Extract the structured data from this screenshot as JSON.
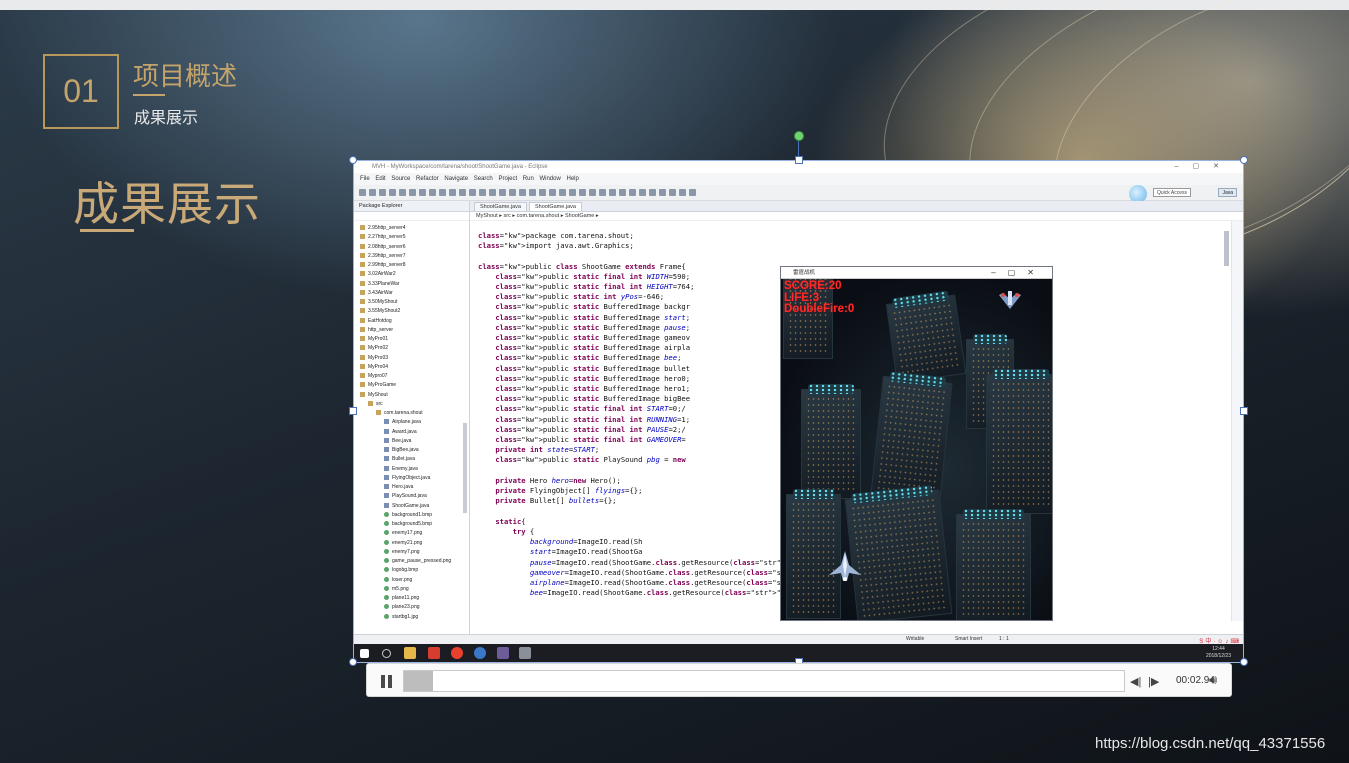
{
  "slide": {
    "section_number": "01",
    "section_title": "项目概述",
    "section_subtitle": "成果展示",
    "main_title": "成果展示",
    "watermark": "https://blog.csdn.net/qq_43371556"
  },
  "eclipse": {
    "window_title": "MVH - MyWorkspace/com/tarena/shoot/ShootGame.java - Eclipse",
    "menu": [
      "File",
      "Edit",
      "Source",
      "Refactor",
      "Navigate",
      "Search",
      "Project",
      "Run",
      "Window",
      "Help"
    ],
    "quick_access": "Quick Access",
    "perspective": "Java",
    "package_explorer_title": "Package Explorer",
    "tree_items": [
      "2.95http_server4",
      "2.27http_server5",
      "2.08http_server6",
      "2.39http_server7",
      "2.99http_server8",
      "3.02AirWar2",
      "3.33PlaneWar",
      "3.43AirWar",
      "3.50MyShout",
      "3.55MyShout2",
      "EatHotdog",
      "http_server",
      "MyPro01",
      "MyPro02",
      "MyPro03",
      "MyPro04",
      "Mypro07",
      "MyProGame",
      "MyShout",
      "src",
      "com.tarena.shout",
      "Airplane.java",
      "Award.java",
      "Bee.java",
      "BigBee.java",
      "Bullet.java",
      "Enemy.java",
      "FlyingObject.java",
      "Hero.java",
      "PlaySound.java",
      "ShootGame.java",
      "background1.bmp",
      "background5.bmp",
      "enemy17.png",
      "enemy21.png",
      "enemy7.png",
      "game_pause_pressed.png",
      "logobg.bmp",
      "loser.png",
      "m5.png",
      "plane11.png",
      "plane23.png",
      "startbg1.jpg"
    ],
    "tabs": [
      "ShootGame.java",
      "ShootGame.java"
    ],
    "breadcrumb": "MyShout ▸ src ▸ com.tarena.shout ▸ ShootGame ▸",
    "status_writable": "Writable",
    "status_insert": "Smart Insert",
    "status_pos": "1 : 1",
    "clock_time": "12:44",
    "clock_date": "2018/12/23"
  },
  "code_lines": [
    "package com.tarena.shout;",
    "import java.awt.Graphics;",
    "",
    "public class ShootGame extends Frame{",
    "    public static final int WIDTH=590;",
    "    public static final int HEIGHT=764;",
    "    public static int yPos=-646;",
    "    public static BufferedImage backgr",
    "    public static BufferedImage start;",
    "    public static BufferedImage pause;",
    "    public static BufferedImage gameov",
    "    public static BufferedImage airpla",
    "    public static BufferedImage bee;",
    "    public static BufferedImage bullet",
    "    public static BufferedImage hero0;",
    "    public static BufferedImage hero1;",
    "    public static BufferedImage bigBee",
    "    public static final int START=0;/",
    "    public static final int RUNNING=1;",
    "    public static final int PAUSE=2;/",
    "    public static final int GAMEOVER=",
    "    private int state=START;",
    "    public static PlaySound pbg = new",
    "",
    "    private Hero hero=new Hero();",
    "    private FlyingObject[] flyings={};",
    "    private Bullet[] bullets={};",
    "",
    "    static{",
    "        try {",
    "            background=ImageIO.read(Sh",
    "            start=ImageIO.read(ShootGa",
    "            pause=ImageIO.read(ShootGame.class.getResource(\"game_pause_pressed.png\"));",
    "            gameover=ImageIO.read(ShootGame.class.getResource(\"loser.png\"));",
    "            airplane=ImageIO.read(ShootGame.class.getResource(\"enemy17.png\"));",
    "            bee=ImageIO.read(ShootGame.class.getResource(\"enemy7.png\"));"
  ],
  "game": {
    "window_title": "雷霆战机",
    "score": "SCORE:20",
    "life": "LIFE:3",
    "double_fire": "DoubleFire:0"
  },
  "player": {
    "time": "00:02.94",
    "progress": 0.04,
    "state": "playing"
  }
}
